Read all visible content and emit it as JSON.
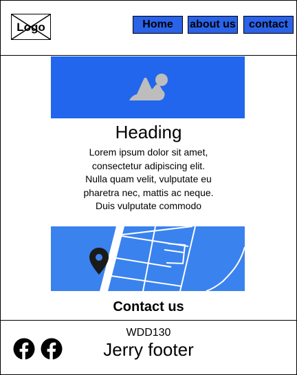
{
  "header": {
    "logo_text": "Logo",
    "nav": {
      "home": "Home",
      "about": "about us",
      "contact": "contact"
    }
  },
  "main": {
    "hero_image_icon": "image-icon",
    "heading": "Heading",
    "paragraph_lines": [
      "Lorem ipsum dolor sit amet,",
      "consectetur adipiscing elit.",
      "Nulla quam velit, vulputate eu",
      "pharetra nec, mattis ac neque.",
      "Duis vulputate commodo"
    ],
    "map_icon": "map-pin-icon",
    "contact_heading": "Contact us"
  },
  "footer": {
    "course": "WDD130",
    "name": "Jerry footer",
    "social_icons": [
      "facebook-icon",
      "facebook-icon"
    ]
  },
  "colors": {
    "nav_button": "#2a62e8",
    "hero": "#2166ec",
    "map": "#3a82ee"
  }
}
